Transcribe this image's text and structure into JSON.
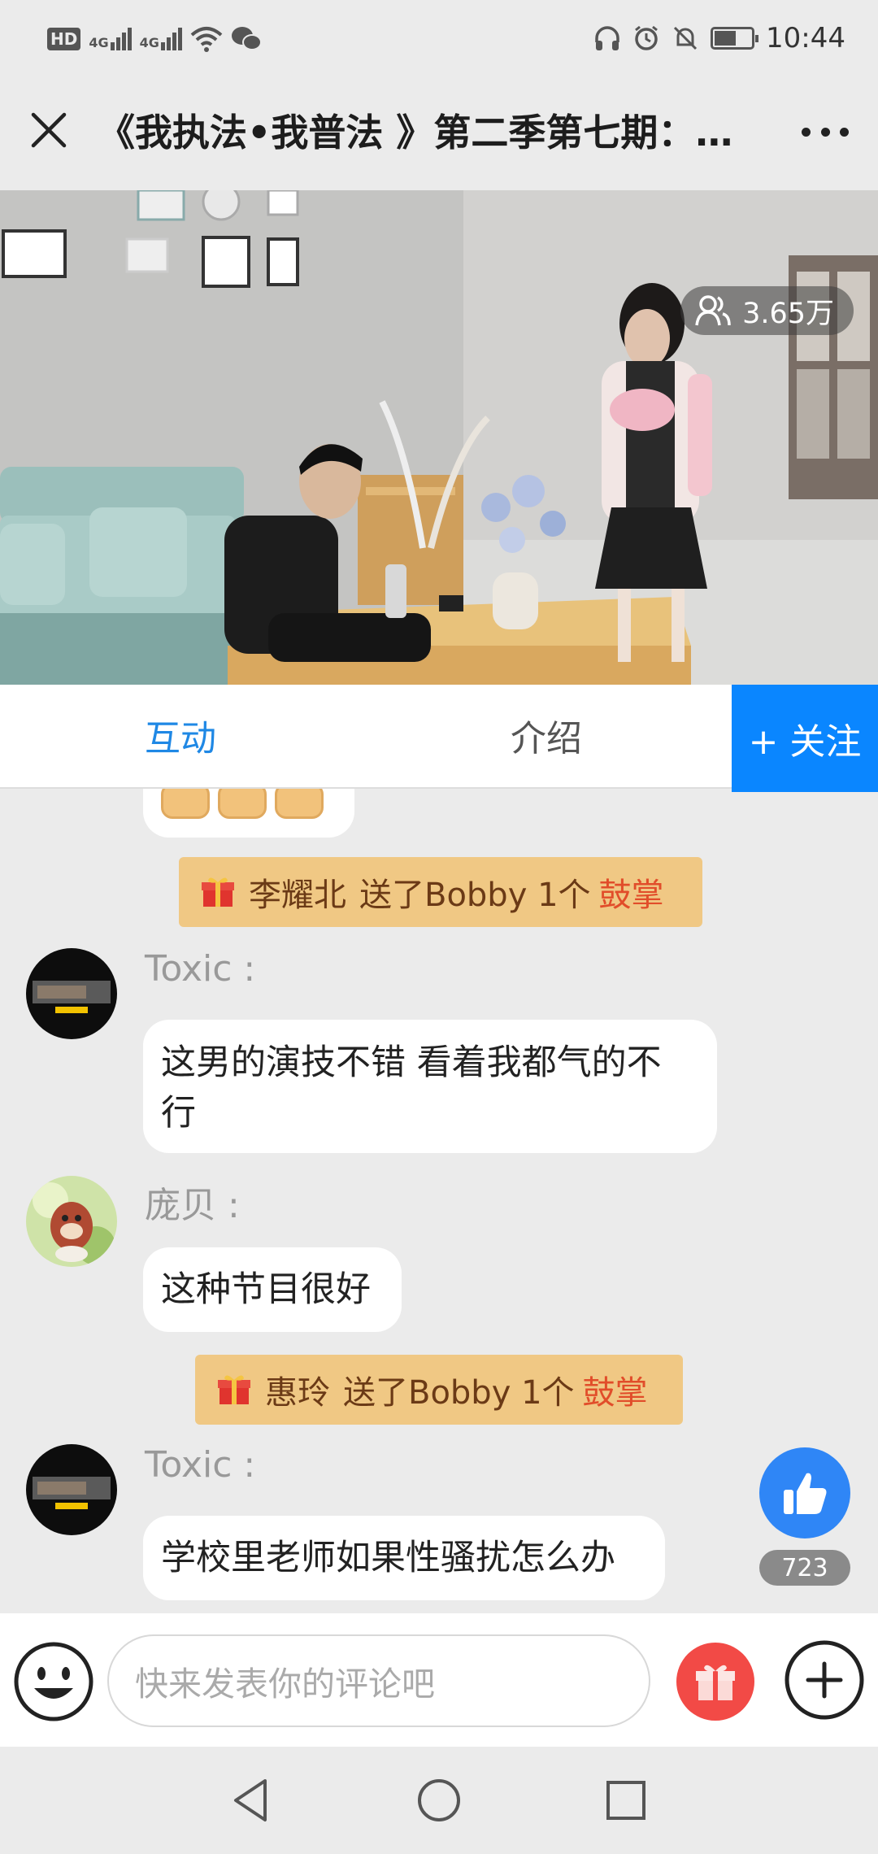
{
  "status_bar": {
    "hd_label": "HD",
    "signal1_label": "4G",
    "signal2_label": "4G",
    "time": "10:44"
  },
  "header": {
    "title": "《我执法•我普法 》第二季第七期：…"
  },
  "video": {
    "viewer_count": "3.65万"
  },
  "tabs": {
    "interact_label": "互动",
    "intro_label": "介绍",
    "follow_label": "+ 关注"
  },
  "chat": {
    "gifts": [
      {
        "sender": "李耀北",
        "text": "送了Bobby 1个",
        "gift": "鼓掌"
      },
      {
        "sender": "惠玲",
        "text": "送了Bobby 1个",
        "gift": "鼓掌"
      }
    ],
    "messages": [
      {
        "user": "Toxic :",
        "text_line1": "这男的演技不错 看着我都气的不",
        "text_line2": "行"
      },
      {
        "user": "庞贝 :",
        "text_line1": "这种节目很好"
      },
      {
        "user": "Toxic :",
        "text_line1": "学校里老师如果性骚扰怎么办"
      }
    ]
  },
  "like": {
    "count": "723"
  },
  "input_bar": {
    "placeholder": "快来发表你的评论吧"
  },
  "colors": {
    "accent_blue": "#0a86ff",
    "tab_active": "#1f88e5",
    "gift_banner": "#f0c884",
    "gift_red": "#f24a46"
  }
}
